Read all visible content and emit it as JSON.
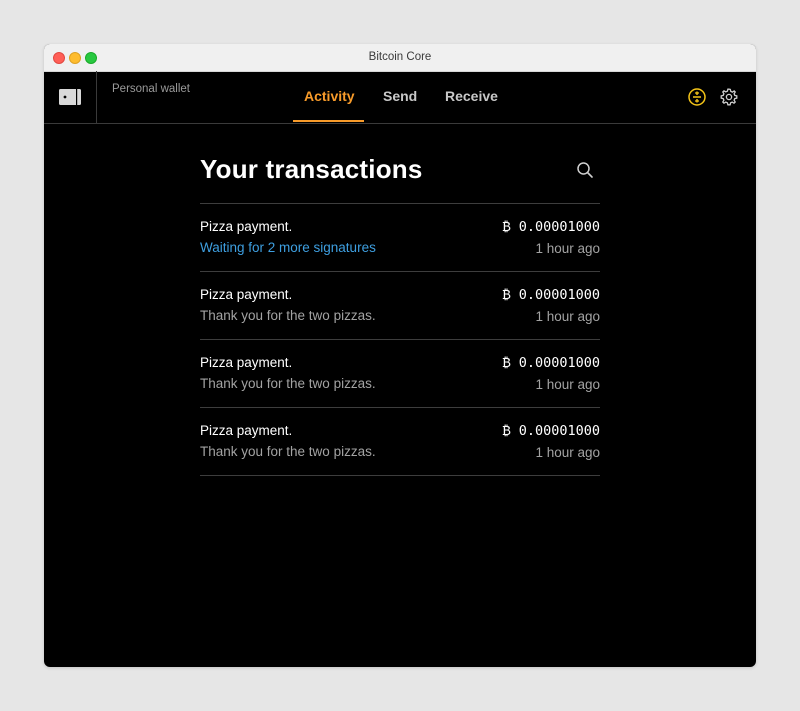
{
  "window": {
    "title": "Bitcoin Core"
  },
  "header": {
    "wallet_name": "Personal wallet",
    "tabs": [
      {
        "label": "Activity",
        "active": true
      },
      {
        "label": "Send",
        "active": false
      },
      {
        "label": "Receive",
        "active": false
      }
    ],
    "icons": [
      "wallet-icon",
      "network-status-icon",
      "gear-icon"
    ]
  },
  "main": {
    "title": "Your transactions",
    "search_icon": "search-icon",
    "transactions": [
      {
        "label": "Pizza payment.",
        "note": "Waiting for 2 more signatures",
        "status": "pending",
        "amount": "₿ 0.00001000",
        "time": "1 hour ago"
      },
      {
        "label": "Pizza payment.",
        "note": "Thank you for the two pizzas.",
        "status": "confirmed",
        "amount": "₿ 0.00001000",
        "time": "1 hour ago"
      },
      {
        "label": "Pizza payment.",
        "note": "Thank you for the two pizzas.",
        "status": "confirmed",
        "amount": "₿ 0.00001000",
        "time": "1 hour ago"
      },
      {
        "label": "Pizza payment.",
        "note": "Thank you for the two pizzas.",
        "status": "confirmed",
        "amount": "₿ 0.00001000",
        "time": "1 hour ago"
      }
    ]
  },
  "colors": {
    "accent": "#f89b2a",
    "pending_text": "#3e9fe0",
    "status_icon": "#f5c518",
    "background": "#000000"
  }
}
